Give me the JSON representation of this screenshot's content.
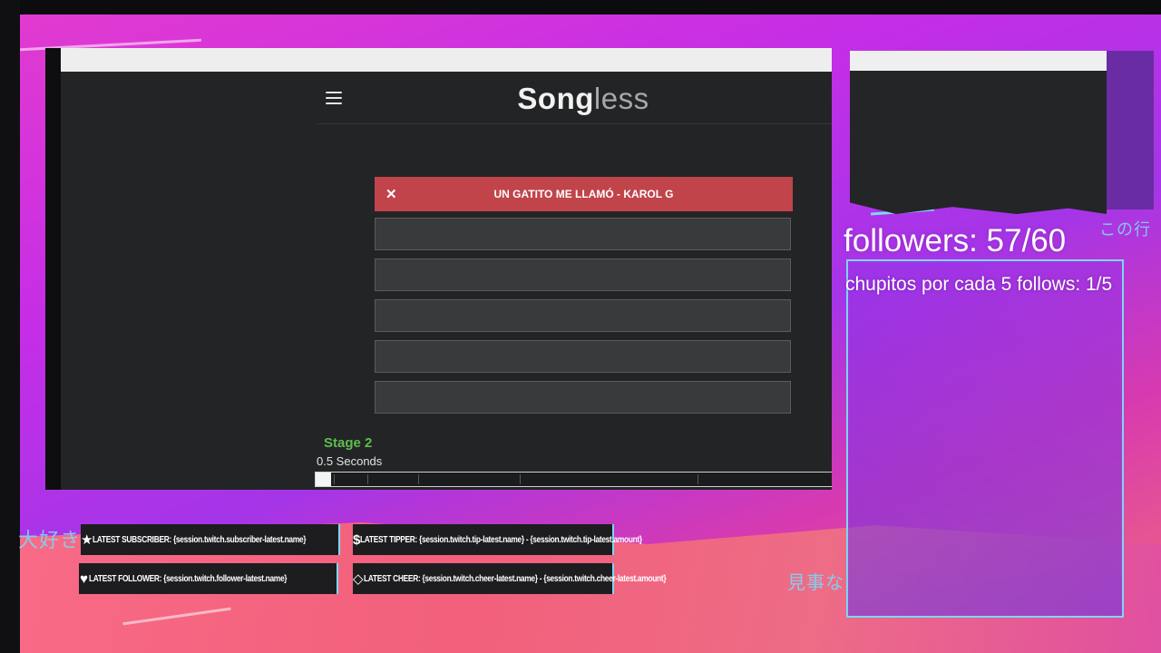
{
  "app": {
    "title_bold": "Song",
    "title_light": "less",
    "menu_icon": "hamburger-menu-icon"
  },
  "guesses": [
    {
      "status": "wrong",
      "text": "UN GATITO ME LLAMÓ - KAROL G",
      "icon": "close-icon"
    },
    {
      "status": "empty",
      "text": ""
    },
    {
      "status": "empty",
      "text": ""
    },
    {
      "status": "empty",
      "text": ""
    },
    {
      "status": "empty",
      "text": ""
    },
    {
      "status": "empty",
      "text": ""
    }
  ],
  "stage": {
    "label": "Stage 2",
    "duration": "0.5 Seconds",
    "progress_fraction": 0.03
  },
  "overlay": {
    "followers": "followers: 57/60",
    "chupitos": "chupitos por cada 5 follows: 1/5",
    "jp_left": "大好き",
    "jp_right_bottom": "見事な",
    "jp_right_top": "この行"
  },
  "widgets": {
    "latest_subscriber": "LATEST SUBSCRIBER: {session.twitch.subscriber-latest.name}",
    "latest_tipper": "LATEST TIPPER: {session.twitch.tip-latest.name} - {session.twitch.tip-latest.amount}",
    "latest_follower": "LATEST FOLLOWER: {session.twitch.follower-latest.name}",
    "latest_cheer": "LATEST CHEER: {session.twitch.cheer-latest.name} - {session.twitch.cheer-latest.amount}"
  },
  "colors": {
    "accent_green": "#5fbd4e",
    "wrong_red": "#c1444b",
    "overlay_cyan": "#7ed6f5",
    "overlay_magenta": "#e23ad0"
  }
}
